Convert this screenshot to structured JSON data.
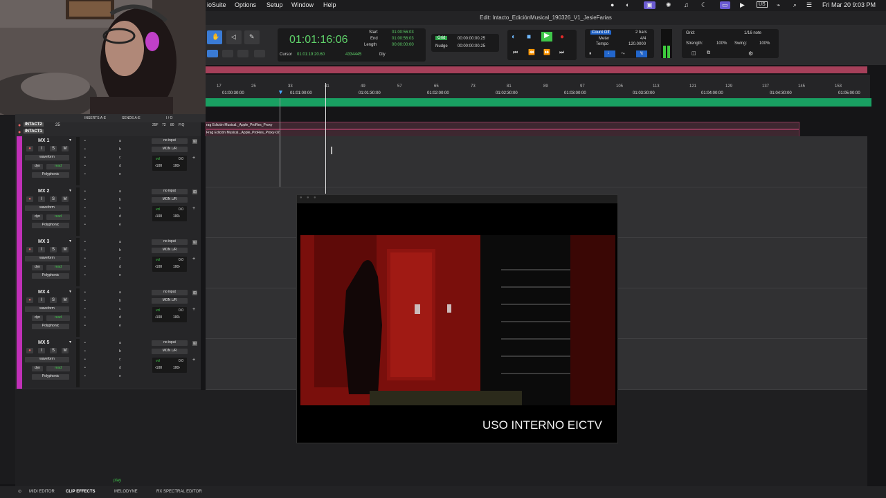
{
  "menubar": {
    "app_name": "ioSuite",
    "items": [
      "Options",
      "Setup",
      "Window",
      "Help"
    ],
    "keyboard": "US",
    "clock": "Fri Mar 20  9:03 PM"
  },
  "window": {
    "title": "Edit: Intacto_EdiciónMusical_190326_V1_JesieFarias"
  },
  "counter": {
    "main_time": "01:01:16:06",
    "start_label": "Start",
    "end_label": "End",
    "length_label": "Length",
    "start_value": "01:00:56:03",
    "end_value": "01:00:56:03",
    "length_value": "00:00:00:00",
    "cursor_label": "Cursor",
    "cursor_value": "01:01:19:20.60",
    "cursor_samples": "4334445",
    "dly_label": "Dly"
  },
  "grid_nudge": {
    "grid_label": "Grid",
    "grid_value": "00:00:00:00.25",
    "nudge_label": "Nudge",
    "nudge_value": "00:00:00:00.25"
  },
  "midi_controls": {
    "count_off": "Count Off",
    "meter_label": "Meter",
    "tempo_label": "Tempo",
    "bars": "2 bars",
    "meter_value": "4/4",
    "tempo_value": "120.0000"
  },
  "grid_panel": {
    "grid_label": "Grid:",
    "grid_value": "1/16 note",
    "strength_label": "Strength:",
    "strength_value": "100%",
    "swing_label": "Swing:",
    "swing_value": "100%"
  },
  "ruler": {
    "bars": [
      "17",
      "25",
      "33",
      "41",
      "49",
      "57",
      "65",
      "73",
      "81",
      "89",
      "97",
      "105",
      "113",
      "121",
      "129",
      "137",
      "145",
      "153"
    ],
    "timecodes": [
      "01:00:30:00",
      "01:01:00:00",
      "01:01:30:00",
      "01:02:00:00",
      "01:02:30:00",
      "01:03:00:00",
      "01:03:30:00",
      "01:04:00:00",
      "01:04:30:00",
      "01:05:00:00"
    ]
  },
  "track_header": {
    "inserts": "INSERTS A-E",
    "sends": "SENDS A-E",
    "io": "I / O"
  },
  "video_tracks": [
    {
      "name": "INTACT2",
      "num": "25",
      "clip": "rag Edición Musical._Apple_ProRes_Proxy"
    },
    {
      "name": "INTACT1",
      "num": "",
      "clip": "Frag Edición Musical._Apple_ProRes_Proxy-02"
    }
  ],
  "video_track_extra": {
    "labels": [
      "25F",
      "72",
      "80",
      "FIQ"
    ]
  },
  "tracks": [
    {
      "name": "MX 1",
      "input": "no input",
      "output": "MON L/R",
      "mode": "waveform",
      "dyn": "dyn",
      "read": "read",
      "plugin": "Polyphonic",
      "vol_label": "vol",
      "vol_value": "0.0",
      "pan_l": "‹100",
      "pan_r": "100›"
    },
    {
      "name": "MX 2",
      "input": "no input",
      "output": "MON L/R",
      "mode": "waveform",
      "dyn": "dyn",
      "read": "read",
      "plugin": "Polyphonic",
      "vol_label": "vol",
      "vol_value": "0.0",
      "pan_l": "‹100",
      "pan_r": "100›"
    },
    {
      "name": "MX 3",
      "input": "no input",
      "output": "MON L/R",
      "mode": "waveform",
      "dyn": "dyn",
      "read": "read",
      "plugin": "Polyphonic",
      "vol_label": "vol",
      "vol_value": "0.0",
      "pan_l": "‹100",
      "pan_r": "100›"
    },
    {
      "name": "MX 4",
      "input": "no input",
      "output": "MON L/R",
      "mode": "waveform",
      "dyn": "dyn",
      "read": "read",
      "plugin": "Polyphonic",
      "vol_label": "vol",
      "vol_value": "0.0",
      "pan_l": "‹100",
      "pan_r": "100›"
    },
    {
      "name": "MX 5",
      "input": "no input",
      "output": "MON L/R",
      "mode": "waveform",
      "dyn": "dyn",
      "read": "read",
      "plugin": "Polyphonic",
      "vol_label": "vol",
      "vol_value": "0.0",
      "pan_l": "‹100",
      "pan_r": "100›"
    }
  ],
  "track_buttons": {
    "i": "I",
    "s": "S",
    "m": "M"
  },
  "insert_slots": [
    "a",
    "b",
    "c",
    "d",
    "e"
  ],
  "video": {
    "watermark": "USO INTERNO EICTV"
  },
  "bottom": {
    "status": "play",
    "tabs": [
      "MIDI EDITOR",
      "CLIP EFFECTS",
      "MELODYNE",
      "RX SPECTRAL EDITOR"
    ]
  }
}
